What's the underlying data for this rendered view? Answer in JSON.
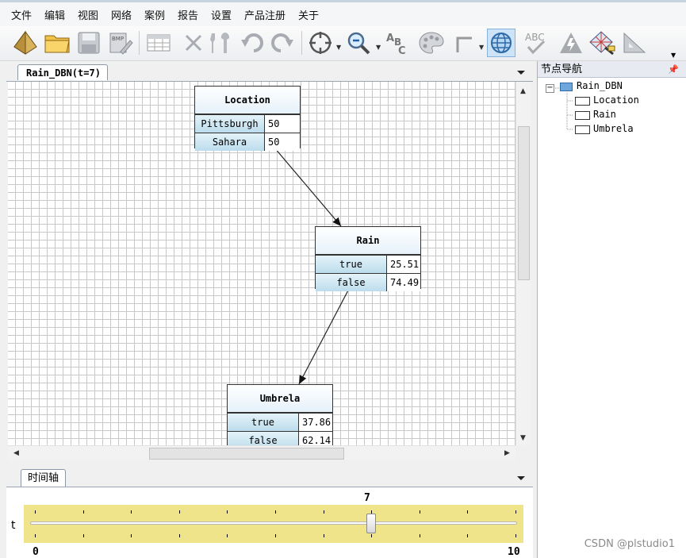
{
  "menu": [
    "文件",
    "编辑",
    "视图",
    "网络",
    "案例",
    "报告",
    "设置",
    "产品注册",
    "关于"
  ],
  "toolbar": {
    "icons": [
      "new-network-icon",
      "open-folder-icon",
      "save-icon",
      "save-image-icon",
      "table-icon",
      "delete-icon",
      "tools-icon",
      "undo-icon",
      "redo-icon",
      "target-icon",
      "zoom-icon",
      "spell-icon",
      "palette-icon",
      "connector-icon",
      "globe-icon",
      "abc-check-icon",
      "warning-icon",
      "diamond-grid-icon",
      "ruler-icon"
    ]
  },
  "document": {
    "tab_title": "Rain_DBN(t=7)"
  },
  "network": {
    "nodes": [
      {
        "title": "Location",
        "states": [
          {
            "name": "Pittsburgh",
            "value": "50"
          },
          {
            "name": "Sahara",
            "value": "50"
          }
        ]
      },
      {
        "title": "Rain",
        "states": [
          {
            "name": "true",
            "value": "25.51"
          },
          {
            "name": "false",
            "value": "74.49"
          }
        ]
      },
      {
        "title": "Umbrela",
        "states": [
          {
            "name": "true",
            "value": "37.86"
          },
          {
            "name": "false",
            "value": "62.14"
          }
        ]
      }
    ]
  },
  "timeline": {
    "tab_title": "时间轴",
    "axis_label": "t",
    "min_label": "0",
    "max_label": "10",
    "current_label": "7",
    "min": 0,
    "max": 10,
    "current": 7
  },
  "navigator": {
    "title": "节点导航",
    "pin_glyph": "📌",
    "collapse_glyph": "−",
    "root": "Rain_DBN",
    "children": [
      "Location",
      "Rain",
      "Umbrela"
    ]
  },
  "watermark": "CSDN @plstudio1",
  "colors": {
    "timeline_strip": "#efe48a",
    "node_state_cell": "#cde6f2",
    "canvas_grid": "#c8c8c8"
  }
}
